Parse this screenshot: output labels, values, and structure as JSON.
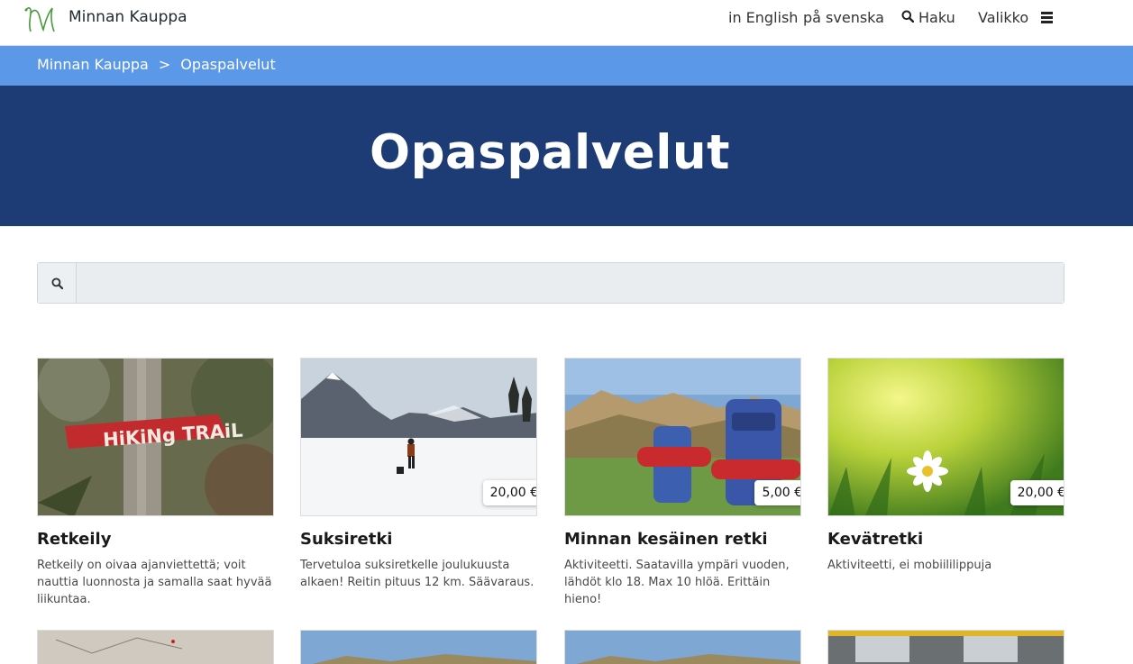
{
  "header": {
    "site_name": "Minnan Kauppa",
    "lang_english": "in English",
    "lang_swedish": "på svenska",
    "search_label": "Haku",
    "menu_label": "Valikko",
    "logo_color": "#4a9a3e"
  },
  "breadcrumb": {
    "home": "Minnan Kauppa",
    "separator": ">",
    "current": "Opaspalvelut"
  },
  "hero": {
    "title": "Opaspalvelut",
    "background": "#1d3b75"
  },
  "search": {
    "placeholder": "",
    "value": ""
  },
  "products": [
    {
      "title": "Retkeily",
      "price": "",
      "description": "Retkeily on oivaa ajanviettettä; voit nauttia luonnosta ja samalla saat hyvää liikuntaa.",
      "image": "hiking-trail-sign"
    },
    {
      "title": "Suksiretki",
      "price": "20,00 €",
      "description": "Tervetuloa suksiretkelle joulukuusta alkaen! Reitin pituus 12 km. Säävaraus.",
      "image": "snowy-mountains"
    },
    {
      "title": "Minnan kesäinen retki",
      "price": "5,00 €",
      "description": "Aktiviteetti. Saatavilla ympäri vuoden, lähdöt klo 18. Max 10 hlöä. Erittäin hieno!",
      "image": "backpacks-meadow"
    },
    {
      "title": "Kevätretki",
      "price": "20,00 €",
      "description": "Aktiviteetti, ei mobiililippuja",
      "image": "daisy-in-grass"
    }
  ],
  "colors": {
    "breadcrumb_bar": "#5b98e8",
    "hero": "#1d3b75"
  }
}
